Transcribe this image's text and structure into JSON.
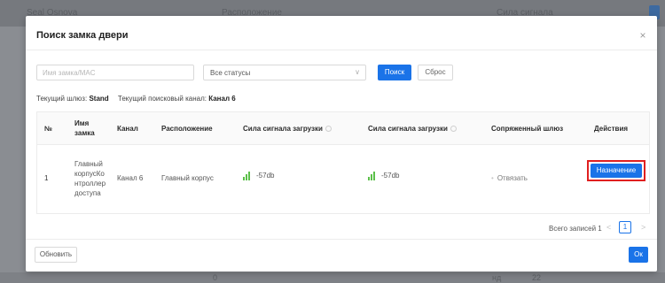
{
  "background": {
    "top_labels": [
      "Seal Osnova",
      "Расположение",
      "Сила сигнала"
    ],
    "bottom_labels": [
      "0",
      "нд",
      "22"
    ]
  },
  "modal": {
    "title": "Поиск замка двери",
    "close_icon": "×"
  },
  "filters": {
    "search_placeholder": "Имя замка/MAC",
    "status_value": "Все статусы",
    "search_button": "Поиск",
    "reset_button": "Сброс"
  },
  "info": {
    "gateway_label": "Текущий шлюз:",
    "gateway_value": "Stand",
    "channel_label": "Текущий поисковый канал:",
    "channel_value": "Канал 6"
  },
  "table": {
    "headers": {
      "no": "№",
      "lock_name": "Имя замка",
      "channel": "Канал",
      "location": "Расположение",
      "signal_download_1": "Сила сигнала загрузки",
      "signal_download_2": "Сила сигнала загрузки",
      "paired_gateway": "Сопряженный шлюз",
      "actions": "Действия"
    },
    "rows": [
      {
        "no": "1",
        "lock_name": "Главный корпусКонтроллер доступа",
        "lock_name_lines": [
          "Главный",
          "корпусКо",
          "нтроллер",
          "доступа"
        ],
        "channel": "Канал 6",
        "location": "Главный корпус",
        "signal_1": "-57db",
        "signal_2": "-57db",
        "paired_gateway": "Отвязать",
        "action": "Назначение"
      }
    ]
  },
  "pagination": {
    "total_text": "Всего записей 1",
    "prev": "<",
    "current_page": "1",
    "next": ">"
  },
  "footer": {
    "refresh_button": "Обновить",
    "ok_button": "Ок"
  },
  "colors": {
    "primary": "#1a73e8",
    "signal_green": "#5cc04a",
    "highlight_red": "#e02020"
  }
}
